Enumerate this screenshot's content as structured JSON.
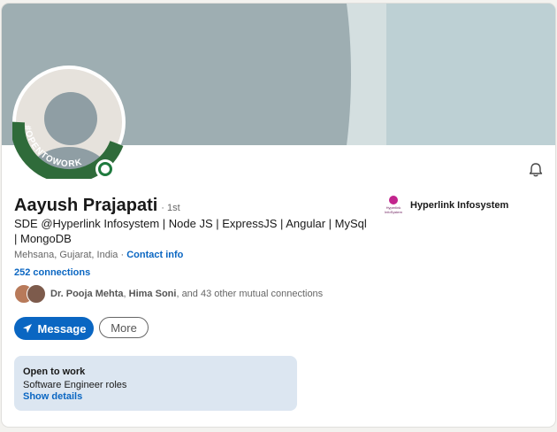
{
  "profile": {
    "name": "Aayush Prajapati",
    "degree": "· 1st",
    "headline": "SDE @Hyperlink Infosystem | Node JS | ExpressJS | Angular | MySql | MongoDB",
    "location": "Mehsana, Gujarat, India",
    "location_separator": " · ",
    "contact_info": "Contact info",
    "connections": "252 connections",
    "open_to_work_badge": "#OPENTOWORK"
  },
  "mutual": {
    "name1": "Dr. Pooja Mehta",
    "sep": ", ",
    "name2": "Hima Soni",
    "rest": ", and 43 other mutual connections"
  },
  "company": {
    "name": "Hyperlink Infosystem",
    "logo_line1": "Hyperlink",
    "logo_line2": "InfoSystem"
  },
  "actions": {
    "message_label": "Message",
    "more_label": "More"
  },
  "open_to_work": {
    "title": "Open to work",
    "roles": "Software Engineer roles",
    "link": "Show details"
  },
  "colors": {
    "brand_blue": "#0a66c2",
    "open_to_work_green": "#1f7a3e",
    "panel_bg": "#dce6f1"
  },
  "icons": [
    "bell-icon",
    "send-icon"
  ]
}
